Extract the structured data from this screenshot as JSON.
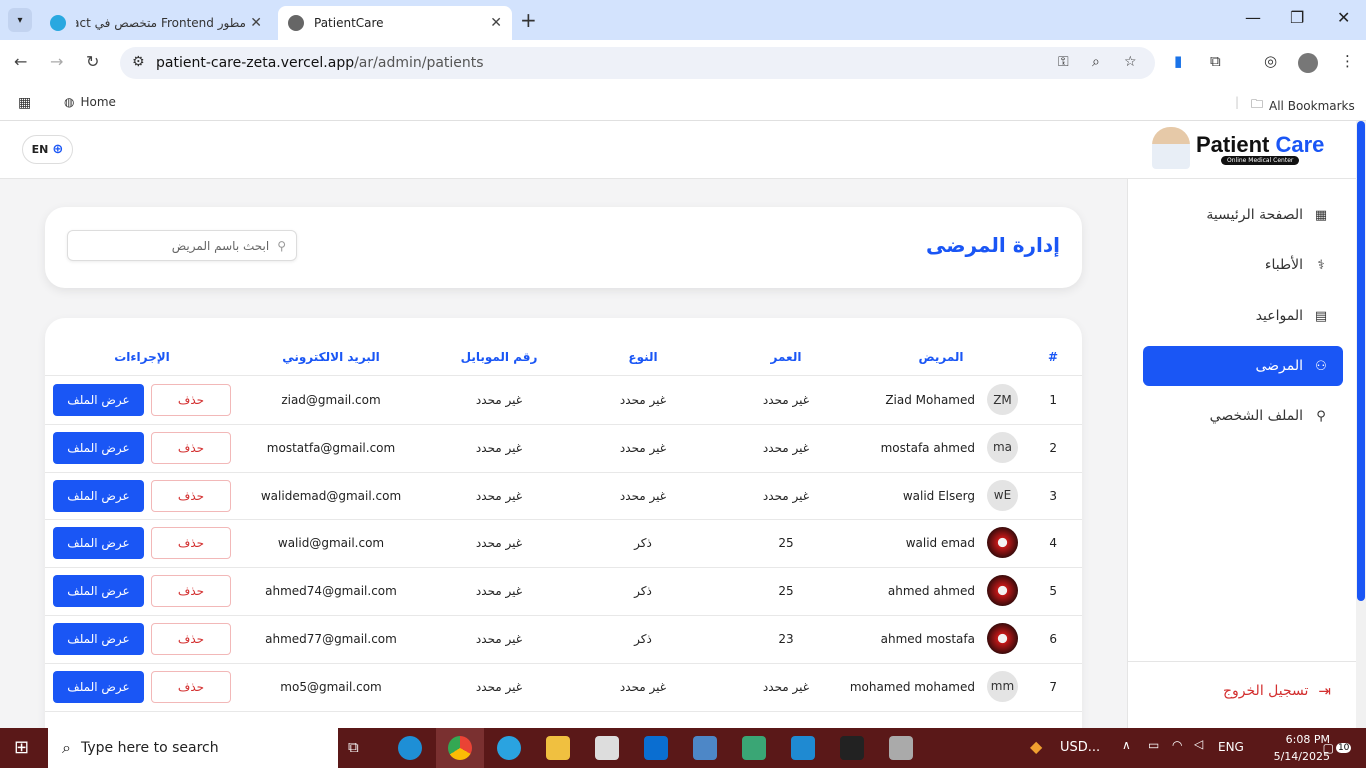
{
  "browser": {
    "tabs": [
      {
        "label": "مطور Frontend متخصص في React"
      },
      {
        "label": "PatientCare"
      }
    ],
    "url_host": "patient-care-zeta.vercel.app",
    "url_path": "/ar/admin/patients",
    "bookmarks": {
      "home": "Home",
      "all": "All Bookmarks"
    }
  },
  "app": {
    "lang_button": "EN",
    "logo": {
      "word1": "Patient",
      "word2": "Care",
      "tagline": "Online Medical Center"
    },
    "sidebar": {
      "items": [
        {
          "label": "الصفحة الرئيسية",
          "icon": "grid-icon",
          "active": false
        },
        {
          "label": "الأطباء",
          "icon": "stethoscope-icon",
          "active": false
        },
        {
          "label": "المواعيد",
          "icon": "calendar-icon",
          "active": false
        },
        {
          "label": "المرضى",
          "icon": "users-icon",
          "active": true
        },
        {
          "label": "الملف الشخصي",
          "icon": "user-icon",
          "active": false
        }
      ],
      "logout": "تسجيل الخروج"
    },
    "page_title": "إدارة المرضى",
    "search_placeholder": "ابحث باسم المريض",
    "table": {
      "headers": {
        "index": "#",
        "patient": "المريض",
        "age": "العمر",
        "gender": "النوع",
        "mobile": "رقم الموبايل",
        "email": "البريد الالكتروني",
        "actions": "الإجراءات"
      },
      "view_label": "عرض الملف",
      "delete_label": "حذف",
      "rows": [
        {
          "index": "1",
          "avatar": "ZM",
          "name": "Ziad Mohamed",
          "age": "غير محدد",
          "gender": "غير محدد",
          "mobile": "غير محدد",
          "email": "ziad@gmail.com"
        },
        {
          "index": "2",
          "avatar": "ma",
          "name": "mostafa ahmed",
          "age": "غير محدد",
          "gender": "غير محدد",
          "mobile": "غير محدد",
          "email": "mostatfa@gmail.com"
        },
        {
          "index": "3",
          "avatar": "wE",
          "name": "walid Elserg",
          "age": "غير محدد",
          "gender": "غير محدد",
          "mobile": "غير محدد",
          "email": "walidemad@gmail.com"
        },
        {
          "index": "4",
          "avatar": "",
          "name": "walid emad",
          "age": "25",
          "gender": "ذكر",
          "mobile": "غير محدد",
          "email": "walid@gmail.com"
        },
        {
          "index": "5",
          "avatar": "",
          "name": "ahmed ahmed",
          "age": "25",
          "gender": "ذكر",
          "mobile": "غير محدد",
          "email": "ahmed74@gmail.com"
        },
        {
          "index": "6",
          "avatar": "",
          "name": "ahmed mostafa",
          "age": "23",
          "gender": "ذكر",
          "mobile": "غير محدد",
          "email": "ahmed77@gmail.com"
        },
        {
          "index": "7",
          "avatar": "mm",
          "name": "mohamed mohamed",
          "age": "غير محدد",
          "gender": "غير محدد",
          "mobile": "غير محدد",
          "email": "mo5@gmail.com"
        }
      ]
    }
  },
  "taskbar": {
    "search": "Type here to search",
    "weather": "USD...",
    "lang": "ENG",
    "time": "6:08 PM",
    "date": "5/14/2025",
    "notifications": "10"
  },
  "colors": {
    "accent": "#1a56f5",
    "danger": "#d32f2f"
  }
}
